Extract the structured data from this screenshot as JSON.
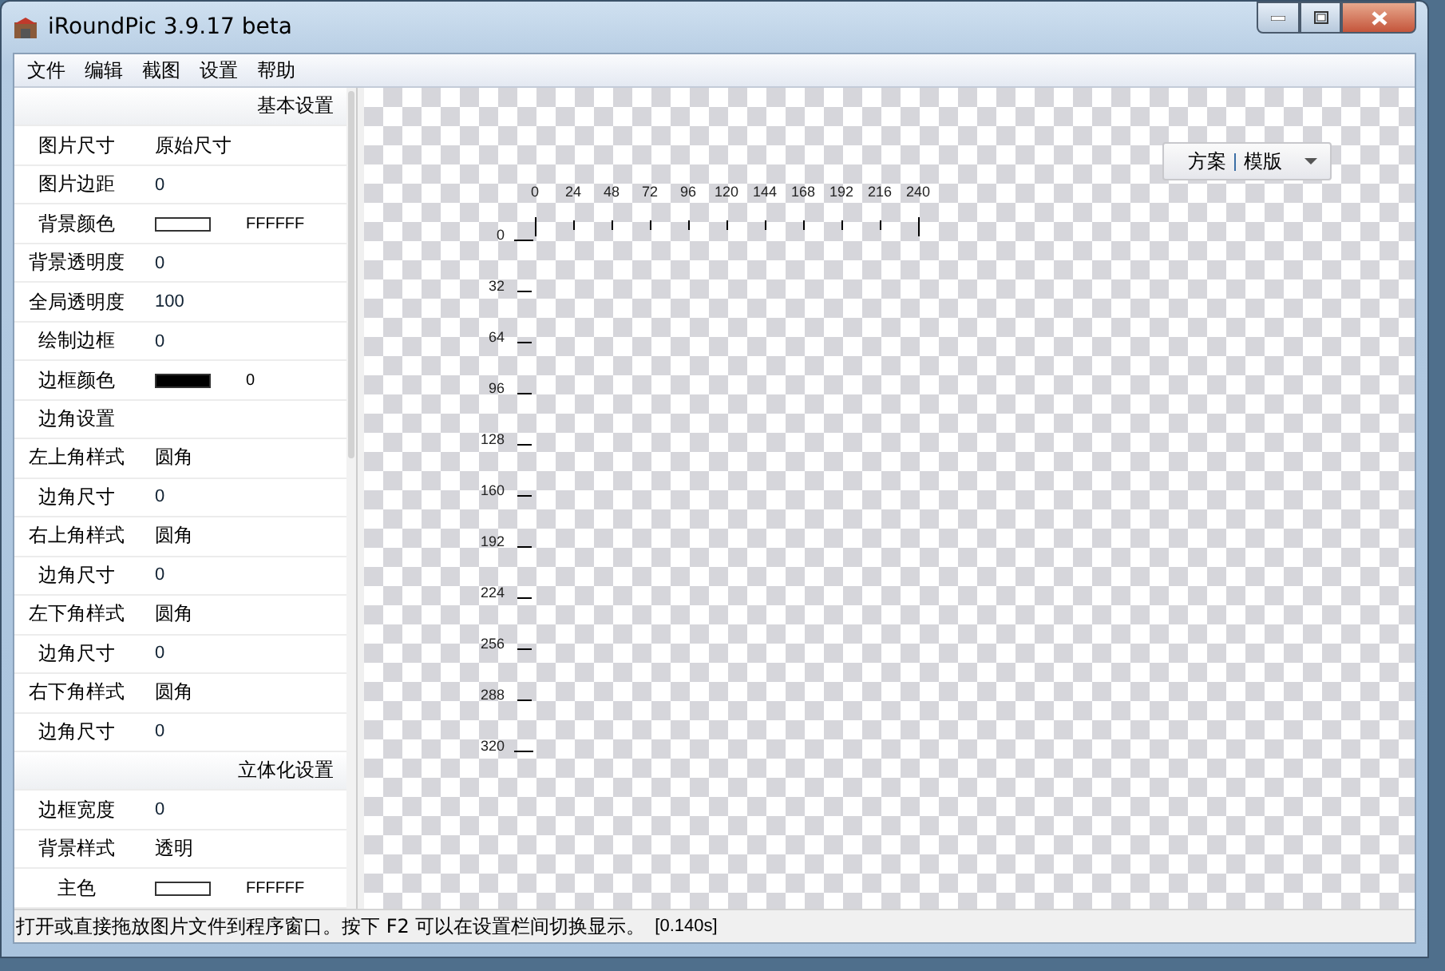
{
  "window": {
    "title": "iRoundPic 3.9.17 beta"
  },
  "menu": [
    "文件",
    "编辑",
    "截图",
    "设置",
    "帮助"
  ],
  "properties": [
    {
      "kind": "section",
      "label": "基本设置"
    },
    {
      "kind": "property",
      "label": "图片尺寸",
      "value": "原始尺寸"
    },
    {
      "kind": "property",
      "label": "图片边距",
      "value": "0"
    },
    {
      "kind": "color",
      "label": "背景颜色",
      "color": "#ffffff",
      "value": "FFFFFF"
    },
    {
      "kind": "property",
      "label": "背景透明度",
      "value": "0"
    },
    {
      "kind": "property",
      "label": "全局透明度",
      "value": "100"
    },
    {
      "kind": "property",
      "label": "绘制边框",
      "value": "0"
    },
    {
      "kind": "color",
      "label": "边框颜色",
      "color": "#000000",
      "value": "0"
    },
    {
      "kind": "property",
      "label": "边角设置"
    },
    {
      "kind": "property",
      "label": "左上角样式",
      "value": "圆角"
    },
    {
      "kind": "property",
      "label": "边角尺寸",
      "value": "0"
    },
    {
      "kind": "property",
      "label": "右上角样式",
      "value": "圆角"
    },
    {
      "kind": "property",
      "label": "边角尺寸",
      "value": "0"
    },
    {
      "kind": "property",
      "label": "左下角样式",
      "value": "圆角"
    },
    {
      "kind": "property",
      "label": "边角尺寸",
      "value": "0"
    },
    {
      "kind": "property",
      "label": "右下角样式",
      "value": "圆角"
    },
    {
      "kind": "property",
      "label": "边角尺寸",
      "value": "0"
    },
    {
      "kind": "section",
      "label": "立体化设置"
    },
    {
      "kind": "property",
      "label": "边框宽度",
      "value": "0"
    },
    {
      "kind": "property",
      "label": "背景样式",
      "value": "透明"
    },
    {
      "kind": "color",
      "label": "主色",
      "color": "#ffffff",
      "value": "FFFFFF"
    }
  ],
  "scheme_button": {
    "left": "方案",
    "right": "模版"
  },
  "ruler": {
    "x_labels": [
      "0",
      "24",
      "48",
      "72",
      "96",
      "120",
      "144",
      "168",
      "192",
      "216",
      "240"
    ],
    "y_labels": [
      "0",
      "32",
      "64",
      "96",
      "128",
      "160",
      "192",
      "224",
      "256",
      "288",
      "320"
    ]
  },
  "status_bar": {
    "message": "打开或直接拖放图片文件到程序窗口。按下 F2 可以在设置栏间切换显示。",
    "timing": "[0.140s]"
  }
}
